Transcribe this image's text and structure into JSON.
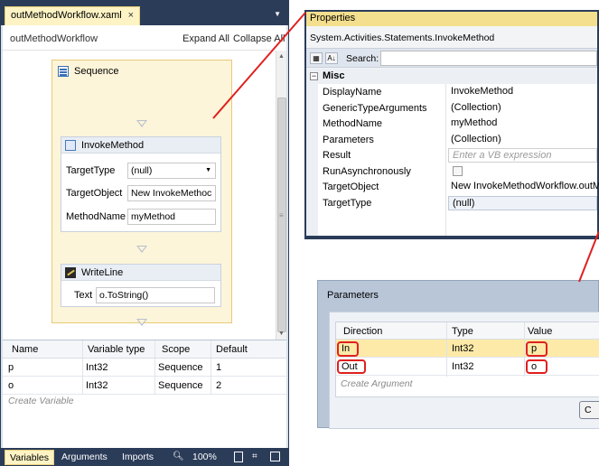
{
  "document_tab": {
    "title": "outMethodWorkflow.xaml",
    "close_glyph": "×",
    "menu_glyph": "▼"
  },
  "designer": {
    "breadcrumb": "outMethodWorkflow",
    "expand_all": "Expand All",
    "collapse_all": "Collapse All",
    "sequence": {
      "title": "Sequence"
    },
    "invoke_method": {
      "title": "InvokeMethod",
      "target_type_label": "TargetType",
      "target_type_value": "(null)",
      "target_object_label": "TargetObject",
      "target_object_value": "New InvokeMethoc",
      "method_name_label": "MethodName",
      "method_name_value": "myMethod"
    },
    "write_line": {
      "title": "WriteLine",
      "text_label": "Text",
      "text_value": "o.ToString()"
    }
  },
  "variables": {
    "columns": [
      "Name",
      "Variable type",
      "Scope",
      "Default"
    ],
    "rows": [
      {
        "name": "p",
        "type": "Int32",
        "scope": "Sequence",
        "default": "1"
      },
      {
        "name": "o",
        "type": "Int32",
        "scope": "Sequence",
        "default": "2"
      }
    ],
    "create_hint": "Create Variable"
  },
  "bottom_bar": {
    "variables": "Variables",
    "arguments": "Arguments",
    "imports": "Imports",
    "zoom": "100%"
  },
  "properties": {
    "title": "Properties",
    "object_type": "System.Activities.Statements.InvokeMethod",
    "search_label": "Search:",
    "category": "Misc",
    "rows": [
      {
        "name": "DisplayName",
        "value": "InvokeMethod"
      },
      {
        "name": "GenericTypeArguments",
        "value": "(Collection)"
      },
      {
        "name": "MethodName",
        "value": "myMethod"
      },
      {
        "name": "Parameters",
        "value": "(Collection)"
      },
      {
        "name": "Result",
        "value": "Enter a VB expression"
      },
      {
        "name": "RunAsynchronously",
        "value": ""
      },
      {
        "name": "TargetObject",
        "value": "New InvokeMethodWorkflow.outM"
      },
      {
        "name": "TargetType",
        "value": "(null)"
      }
    ]
  },
  "parameters_dialog": {
    "title": "Parameters",
    "columns": [
      "Direction",
      "Type",
      "Value"
    ],
    "rows": [
      {
        "direction": "In",
        "type": "Int32",
        "value": "p"
      },
      {
        "direction": "Out",
        "type": "Int32",
        "value": "o"
      }
    ],
    "create_hint": "Create Argument",
    "button_label": "C"
  },
  "colors": {
    "chrome": "#2b3c59",
    "tab_active": "#fdf3c4",
    "sequence_fill": "#fdf5d9",
    "annotation": "#e02020"
  }
}
